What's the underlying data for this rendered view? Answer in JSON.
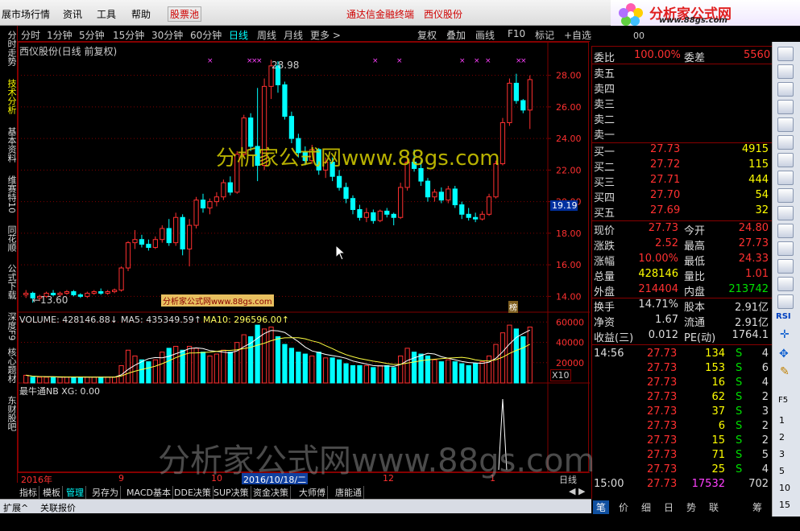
{
  "menubar": {
    "items": [
      "展市场行情",
      "资讯",
      "工具",
      "帮助",
      "股票池",
      "通达信金融终端",
      "西仪股份",
      "行情"
    ]
  },
  "branding": {
    "logo_text": "分析家公式网",
    "logo_url": "www.88gs.com"
  },
  "left_tabs": [
    "分时走势",
    "技术分析",
    "基本资料",
    "维赛特10",
    "同花顺",
    "公式下载",
    "深度F9",
    "核心题材",
    "东财股吧"
  ],
  "period_bar": {
    "periods": [
      "分时",
      "1分钟",
      "5分钟",
      "15分钟",
      "30分钟",
      "60分钟",
      "日线",
      "周线",
      "月线",
      "更多 >"
    ],
    "active": "日线",
    "tools": [
      "复权",
      "叠加",
      "画线",
      "F10",
      "标记",
      "+自选"
    ]
  },
  "chart": {
    "title": "西仪股份(日线 前复权)",
    "high_label": "28.98",
    "low_label": "←13.60",
    "price_ticks": [
      "28.00",
      "26.00",
      "24.00",
      "22.00",
      "20.00",
      "18.00",
      "16.00",
      "14.00"
    ],
    "current_price_tag": "19.19",
    "volume_legend": {
      "vol": "VOLUME: 428146.88↓",
      "ma5": "MA5: 435349.59↑",
      "ma10": "MA10: 296596.00↑"
    },
    "volume_ticks": [
      "60000",
      "40000",
      "20000"
    ],
    "volume_unit": "X10",
    "indicator_legend": "最牛通NB XG: 0.00",
    "date_labels": [
      "2016年",
      "9",
      "10",
      "2016/10/18/二",
      "12",
      "1"
    ],
    "cursor_date": "2016/10/18/二",
    "period_label": "日线",
    "tag_left": "分析家公式网www.88gs.com",
    "tag_right": "榜"
  },
  "chart_data": {
    "type": "bar",
    "title": "西仪股份(日线 前复权)",
    "xlabel": "",
    "ylabel": "",
    "ylim": [
      13,
      29
    ],
    "ohlc": [
      [
        14.1,
        14.4,
        13.9,
        14.2
      ],
      [
        14.2,
        14.3,
        13.6,
        13.9
      ],
      [
        13.9,
        14.1,
        13.7,
        14.0
      ],
      [
        14.0,
        14.3,
        13.9,
        14.2
      ],
      [
        14.2,
        14.4,
        14.0,
        14.1
      ],
      [
        14.1,
        14.3,
        14.0,
        14.2
      ],
      [
        14.2,
        14.4,
        14.1,
        14.3
      ],
      [
        14.3,
        14.4,
        14.0,
        14.1
      ],
      [
        14.1,
        14.2,
        13.9,
        14.0
      ],
      [
        14.0,
        14.3,
        13.9,
        14.2
      ],
      [
        14.2,
        14.4,
        14.1,
        14.3
      ],
      [
        14.3,
        14.5,
        14.1,
        14.2
      ],
      [
        14.2,
        14.4,
        14.1,
        14.3
      ],
      [
        14.3,
        14.5,
        14.2,
        14.4
      ],
      [
        14.4,
        15.9,
        14.3,
        15.8
      ],
      [
        15.8,
        17.5,
        15.6,
        17.4
      ],
      [
        17.4,
        18.2,
        17.0,
        17.6
      ],
      [
        17.6,
        17.9,
        17.1,
        17.3
      ],
      [
        17.3,
        17.6,
        16.9,
        17.1
      ],
      [
        17.1,
        17.8,
        17.0,
        17.6
      ],
      [
        17.6,
        18.5,
        17.4,
        18.3
      ],
      [
        18.3,
        18.9,
        17.2,
        17.4
      ],
      [
        17.4,
        19.3,
        17.2,
        19.0
      ],
      [
        19.0,
        19.2,
        16.6,
        17.0
      ],
      [
        17.0,
        18.9,
        15.9,
        18.5
      ],
      [
        18.5,
        20.3,
        18.3,
        20.1
      ],
      [
        20.1,
        20.5,
        19.3,
        19.6
      ],
      [
        19.6,
        20.2,
        19.2,
        20.0
      ],
      [
        20.0,
        20.6,
        19.7,
        20.3
      ],
      [
        20.3,
        21.4,
        20.1,
        21.2
      ],
      [
        21.2,
        21.6,
        20.4,
        20.6
      ],
      [
        20.6,
        23.2,
        20.5,
        23.0
      ],
      [
        23.0,
        25.5,
        22.8,
        25.3
      ],
      [
        25.3,
        25.6,
        23.2,
        23.5
      ],
      [
        23.5,
        27.2,
        21.3,
        22.3
      ],
      [
        22.3,
        27.8,
        22.0,
        27.3
      ],
      [
        27.3,
        28.98,
        26.5,
        28.6
      ],
      [
        28.6,
        28.9,
        26.9,
        27.4
      ],
      [
        27.4,
        27.6,
        25.2,
        25.4
      ],
      [
        25.4,
        25.7,
        23.7,
        24.0
      ],
      [
        24.0,
        24.3,
        22.8,
        23.1
      ],
      [
        23.1,
        23.5,
        22.3,
        22.6
      ],
      [
        22.6,
        23.6,
        22.4,
        23.3
      ],
      [
        23.3,
        23.4,
        21.7,
        22.0
      ],
      [
        22.0,
        22.8,
        21.5,
        22.5
      ],
      [
        22.5,
        22.8,
        21.3,
        21.6
      ],
      [
        21.6,
        22.0,
        20.7,
        20.9
      ],
      [
        20.9,
        21.2,
        19.9,
        20.2
      ],
      [
        20.2,
        20.4,
        19.2,
        19.5
      ],
      [
        19.5,
        19.8,
        18.8,
        19.0
      ],
      [
        19.0,
        19.6,
        18.7,
        19.3
      ],
      [
        19.3,
        19.5,
        18.6,
        18.8
      ],
      [
        18.8,
        19.5,
        18.7,
        19.4
      ],
      [
        19.4,
        19.6,
        19.0,
        19.2
      ],
      [
        19.2,
        19.3,
        18.5,
        19.0
      ],
      [
        19.0,
        21.2,
        18.9,
        20.9
      ],
      [
        20.9,
        22.9,
        20.7,
        22.5
      ],
      [
        22.5,
        23.3,
        21.9,
        22.1
      ],
      [
        22.1,
        22.6,
        21.0,
        21.3
      ],
      [
        21.3,
        21.5,
        20.0,
        20.3
      ],
      [
        20.3,
        20.8,
        20.0,
        20.6
      ],
      [
        20.6,
        20.9,
        19.9,
        20.1
      ],
      [
        20.1,
        21.0,
        19.9,
        20.8
      ],
      [
        20.8,
        21.0,
        19.6,
        19.8
      ],
      [
        19.8,
        20.0,
        18.9,
        19.2
      ],
      [
        19.2,
        19.6,
        18.8,
        19.0
      ],
      [
        19.0,
        19.3,
        18.7,
        18.9
      ],
      [
        18.9,
        19.4,
        18.8,
        19.2
      ],
      [
        19.2,
        20.5,
        19.1,
        20.3
      ],
      [
        20.3,
        22.6,
        20.2,
        22.4
      ],
      [
        22.4,
        25.3,
        22.3,
        25.0
      ],
      [
        25.0,
        27.8,
        24.8,
        27.5
      ],
      [
        27.5,
        28.1,
        26.2,
        26.4
      ],
      [
        26.4,
        26.5,
        25.6,
        25.8
      ],
      [
        25.8,
        28.0,
        24.6,
        27.73
      ]
    ],
    "volume": [
      4,
      3,
      3,
      3,
      3,
      3,
      3,
      3,
      3,
      3,
      3,
      3,
      3,
      3,
      9,
      17,
      14,
      12,
      11,
      12,
      16,
      18,
      19,
      17,
      19,
      18,
      16,
      14,
      15,
      17,
      16,
      21,
      25,
      24,
      30,
      28,
      29,
      24,
      20,
      18,
      16,
      15,
      14,
      16,
      13,
      13,
      12,
      10,
      9,
      9,
      9,
      8,
      9,
      9,
      8,
      14,
      18,
      16,
      15,
      14,
      12,
      11,
      12,
      11,
      10,
      9,
      10,
      11,
      14,
      20,
      26,
      30,
      28,
      24,
      29
    ],
    "indicator": [
      0,
      0,
      0,
      0,
      0,
      0,
      0,
      0,
      0,
      0,
      0,
      0,
      0,
      0,
      0,
      0,
      0,
      0,
      0,
      0,
      0,
      0,
      0,
      0,
      0,
      0,
      0,
      0,
      0,
      0,
      0,
      0,
      0,
      0,
      0,
      0,
      0,
      0,
      0,
      0,
      0,
      0,
      0,
      0,
      0,
      0,
      0,
      0,
      0,
      0,
      0,
      0,
      0,
      0,
      0,
      0,
      0,
      0,
      0,
      0,
      0,
      0,
      0,
      0,
      0,
      0,
      0,
      0,
      0,
      0,
      1,
      0,
      0,
      0,
      0
    ]
  },
  "quote": {
    "code_hint": "00",
    "weibi_label": "委比",
    "weibi_value": "100.00%",
    "weicha_label": "委差",
    "weicha_value": "5560",
    "sell": [
      {
        "label": "卖五",
        "price": "",
        "vol": ""
      },
      {
        "label": "卖四",
        "price": "",
        "vol": ""
      },
      {
        "label": "卖三",
        "price": "",
        "vol": ""
      },
      {
        "label": "卖二",
        "price": "",
        "vol": ""
      },
      {
        "label": "卖一",
        "price": "",
        "vol": ""
      }
    ],
    "buy": [
      {
        "label": "买一",
        "price": "27.73",
        "vol": "4915"
      },
      {
        "label": "买二",
        "price": "27.72",
        "vol": "115"
      },
      {
        "label": "买三",
        "price": "27.71",
        "vol": "444"
      },
      {
        "label": "买四",
        "price": "27.70",
        "vol": "54"
      },
      {
        "label": "买五",
        "price": "27.69",
        "vol": "32"
      }
    ],
    "stats": [
      [
        {
          "l": "现价",
          "v": "27.73",
          "c": "rd"
        },
        {
          "l": "今开",
          "v": "24.80",
          "c": "rd"
        }
      ],
      [
        {
          "l": "涨跌",
          "v": "2.52",
          "c": "rd"
        },
        {
          "l": "最高",
          "v": "27.73",
          "c": "rd"
        }
      ],
      [
        {
          "l": "涨幅",
          "v": "10.00%",
          "c": "rd"
        },
        {
          "l": "最低",
          "v": "24.33",
          "c": "rd"
        }
      ],
      [
        {
          "l": "总量",
          "v": "428146",
          "c": "yl"
        },
        {
          "l": "量比",
          "v": "1.01",
          "c": "rd"
        }
      ],
      [
        {
          "l": "外盘",
          "v": "214404",
          "c": "rd"
        },
        {
          "l": "内盘",
          "v": "213742",
          "c": "gn"
        }
      ],
      [
        {
          "l": "换手",
          "v": "14.71%",
          "c": "wt"
        },
        {
          "l": "股本",
          "v": "2.91亿",
          "c": "wt"
        }
      ],
      [
        {
          "l": "净资",
          "v": "1.67",
          "c": "wt"
        },
        {
          "l": "流通",
          "v": "2.91亿",
          "c": "wt"
        }
      ],
      [
        {
          "l": "收益(三)",
          "v": "0.012",
          "c": "wt"
        },
        {
          "l": "PE(动)",
          "v": "1764.1",
          "c": "wt"
        }
      ]
    ],
    "ticks": [
      {
        "t": "14:56",
        "p": "27.73",
        "v": "134",
        "s": "S",
        "n": "4"
      },
      {
        "t": "",
        "p": "27.73",
        "v": "153",
        "s": "S",
        "n": "6"
      },
      {
        "t": "",
        "p": "27.73",
        "v": "16",
        "s": "S",
        "n": "4"
      },
      {
        "t": "",
        "p": "27.73",
        "v": "62",
        "s": "S",
        "n": "2"
      },
      {
        "t": "",
        "p": "27.73",
        "v": "37",
        "s": "S",
        "n": "3"
      },
      {
        "t": "",
        "p": "27.73",
        "v": "6",
        "s": "S",
        "n": "2"
      },
      {
        "t": "",
        "p": "27.73",
        "v": "15",
        "s": "S",
        "n": "2"
      },
      {
        "t": "",
        "p": "27.73",
        "v": "71",
        "s": "S",
        "n": "5"
      },
      {
        "t": "",
        "p": "27.73",
        "v": "25",
        "s": "S",
        "n": "4"
      }
    ],
    "close_row": {
      "t": "15:00",
      "p": "27.73",
      "v": "17532",
      "n": "702"
    }
  },
  "right_tabs": [
    "笔",
    "价",
    "细",
    "日",
    "势",
    "联",
    "筹"
  ],
  "tool_strip": [
    "F5",
    "RSI",
    "1",
    "2",
    "3",
    "5",
    "10",
    "15",
    "30"
  ],
  "bottom_tabs": [
    "指标",
    "模板",
    "管理",
    "另存为",
    "MACD基本",
    "DDE决策",
    "SUP决策",
    "资金决策",
    "大师傅",
    "唐能通"
  ],
  "bottom_tabs_active": "管理",
  "bottom_bar": [
    "扩展^",
    "关联报价"
  ],
  "colors": {
    "up": "#ff3030",
    "down": "#00ffff",
    "grid": "#800000",
    "bg": "#000000"
  },
  "watermark": {
    "center": "分析家公式网www.88gs.com",
    "bottom": "分析家公式网www.88gs.com"
  }
}
